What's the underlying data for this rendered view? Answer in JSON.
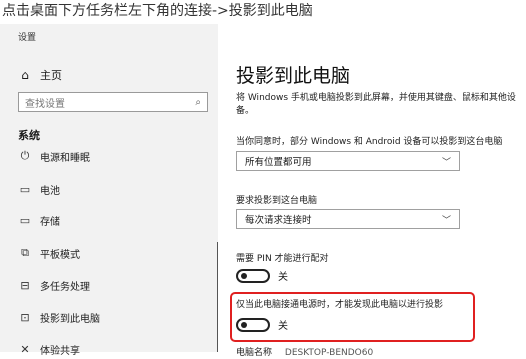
{
  "caption": "点击桌面下方任务栏左下角的连接->投影到此电脑",
  "sidebar": {
    "window_title": "设置",
    "home_label": "主页",
    "search_placeholder": "查找设置",
    "section_label": "系统",
    "items": [
      {
        "label": "电源和睡眠",
        "icon": "power-icon"
      },
      {
        "label": "电池",
        "icon": "battery-icon"
      },
      {
        "label": "存储",
        "icon": "storage-icon"
      },
      {
        "label": "平板模式",
        "icon": "tablet-icon"
      },
      {
        "label": "多任务处理",
        "icon": "multitask-icon"
      },
      {
        "label": "投影到此电脑",
        "icon": "project-icon"
      },
      {
        "label": "体验共享",
        "icon": "share-icon"
      }
    ]
  },
  "main": {
    "title": "投影到此电脑",
    "description": "将 Windows 手机或电脑投影到此屏幕，并使用其键盘、鼠标和其他设备。",
    "availability_label": "当你同意时，部分 Windows 和 Android 设备可以投影到这台电脑",
    "availability_value": "所有位置都可用",
    "request_label": "要求投影到这台电脑",
    "request_value": "每次请求连接时",
    "pin_label": "需要 PIN 才能进行配对",
    "pin_state": "关",
    "power_label": "仅当此电脑接通电源时，才能发现此电脑以进行投影",
    "power_state": "关",
    "pc_name_label": "电脑名称",
    "pc_name_value": "DESKTOP-BENDO60"
  },
  "colors": {
    "highlight": "#e02020",
    "sidebar_bg": "#f2f2f2"
  }
}
